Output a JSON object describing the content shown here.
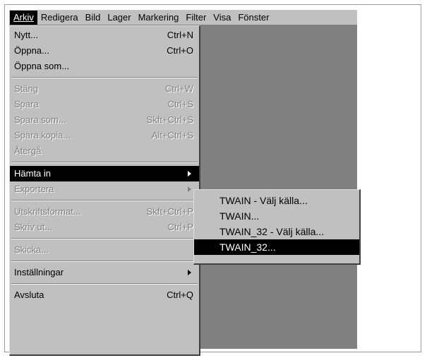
{
  "menubar": {
    "items": [
      {
        "label": "Arkiv"
      },
      {
        "label": "Redigera"
      },
      {
        "label": "Bild"
      },
      {
        "label": "Lager"
      },
      {
        "label": "Markering"
      },
      {
        "label": "Filter"
      },
      {
        "label": "Visa"
      },
      {
        "label": "Fönster"
      }
    ]
  },
  "arkiv_menu": {
    "nytt": {
      "label": "Nytt...",
      "shortcut": "Ctrl+N"
    },
    "oppna": {
      "label": "Öppna...",
      "shortcut": "Ctrl+O"
    },
    "oppna_som": {
      "label": "Öppna som..."
    },
    "stang": {
      "label": "Stäng",
      "shortcut": "Ctrl+W"
    },
    "spara": {
      "label": "Spara",
      "shortcut": "Ctrl+S"
    },
    "spara_som": {
      "label": "Spara som...",
      "shortcut": "Skft+Ctrl+S"
    },
    "spara_kopia": {
      "label": "Spara kopia...",
      "shortcut": "Alt+Ctrl+S"
    },
    "atergaa": {
      "label": "Återgå"
    },
    "hamta_in": {
      "label": "Hämta in"
    },
    "exportera": {
      "label": "Exportera"
    },
    "utskriftsformat": {
      "label": "Utskriftsformat...",
      "shortcut": "Skft+Ctrl+P"
    },
    "skriv_ut": {
      "label": "Skriv ut...",
      "shortcut": "Ctrl+P"
    },
    "skicka": {
      "label": "Skicka..."
    },
    "installningar": {
      "label": "Inställningar"
    },
    "avsluta": {
      "label": "Avsluta",
      "shortcut": "Ctrl+Q"
    }
  },
  "hamta_in_submenu": {
    "items": [
      {
        "label": "TWAIN - Välj källa..."
      },
      {
        "label": "TWAIN..."
      },
      {
        "label": "TWAIN_32 - Välj källa..."
      },
      {
        "label": "TWAIN_32..."
      }
    ]
  },
  "colors": {
    "menu_bg": "#c0c0c0",
    "workspace": "#808080",
    "highlight": "#000000",
    "disabled_text": "#808080"
  },
  "icons": [
    "submenu-arrow-icon"
  ]
}
